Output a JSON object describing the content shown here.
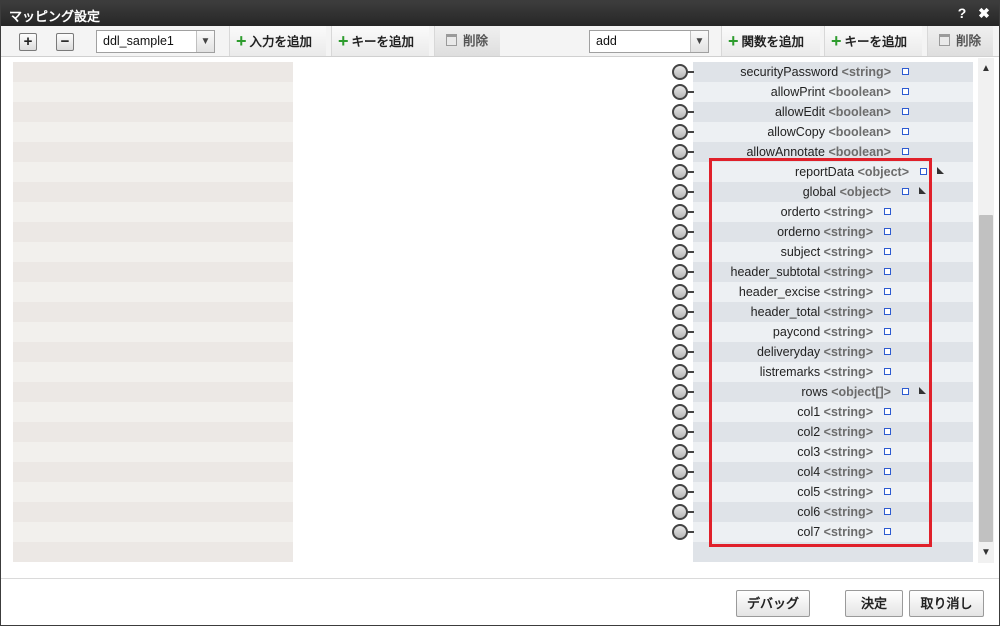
{
  "window": {
    "title": "マッピング設定",
    "help_label": "?",
    "close_label": "✖"
  },
  "toolbar": {
    "expand_label": "+",
    "collapse_label": "−",
    "input_select_value": "ddl_sample1",
    "add_input_label": "入力を追加",
    "add_key_left_label": "キーを追加",
    "delete_left_label": "削除",
    "function_select_value": "add",
    "add_function_label": "関数を追加",
    "add_key_right_label": "キーを追加",
    "delete_right_label": "削除"
  },
  "right_items": [
    {
      "name": "securityPassword",
      "type": "<string>",
      "indent": 0,
      "expand": false
    },
    {
      "name": "allowPrint",
      "type": "<boolean>",
      "indent": 0,
      "expand": false
    },
    {
      "name": "allowEdit",
      "type": "<boolean>",
      "indent": 0,
      "expand": false
    },
    {
      "name": "allowCopy",
      "type": "<boolean>",
      "indent": 0,
      "expand": false
    },
    {
      "name": "allowAnnotate",
      "type": "<boolean>",
      "indent": 0,
      "expand": false
    },
    {
      "name": "reportData",
      "type": "<object>",
      "indent": -1,
      "expand": true
    },
    {
      "name": "global",
      "type": "<object>",
      "indent": 0,
      "expand": true
    },
    {
      "name": "orderto",
      "type": "<string>",
      "indent": 1,
      "expand": false
    },
    {
      "name": "orderno",
      "type": "<string>",
      "indent": 1,
      "expand": false
    },
    {
      "name": "subject",
      "type": "<string>",
      "indent": 1,
      "expand": false
    },
    {
      "name": "header_subtotal",
      "type": "<string>",
      "indent": 1,
      "expand": false
    },
    {
      "name": "header_excise",
      "type": "<string>",
      "indent": 1,
      "expand": false
    },
    {
      "name": "header_total",
      "type": "<string>",
      "indent": 1,
      "expand": false
    },
    {
      "name": "paycond",
      "type": "<string>",
      "indent": 1,
      "expand": false
    },
    {
      "name": "deliveryday",
      "type": "<string>",
      "indent": 1,
      "expand": false
    },
    {
      "name": "listremarks",
      "type": "<string>",
      "indent": 1,
      "expand": false
    },
    {
      "name": "rows",
      "type": "<object[]>",
      "indent": 0,
      "expand": true
    },
    {
      "name": "col1",
      "type": "<string>",
      "indent": 1,
      "expand": false
    },
    {
      "name": "col2",
      "type": "<string>",
      "indent": 1,
      "expand": false
    },
    {
      "name": "col3",
      "type": "<string>",
      "indent": 1,
      "expand": false
    },
    {
      "name": "col4",
      "type": "<string>",
      "indent": 1,
      "expand": false
    },
    {
      "name": "col5",
      "type": "<string>",
      "indent": 1,
      "expand": false
    },
    {
      "name": "col6",
      "type": "<string>",
      "indent": 1,
      "expand": false
    },
    {
      "name": "col7",
      "type": "<string>",
      "indent": 1,
      "expand": false
    }
  ],
  "footer": {
    "debug_label": "デバッグ",
    "ok_label": "決定",
    "cancel_label": "取り消し"
  },
  "colors": {
    "highlight": "#e0202a",
    "port": "#2d5bd1",
    "add_icon": "#2e9c2e"
  }
}
